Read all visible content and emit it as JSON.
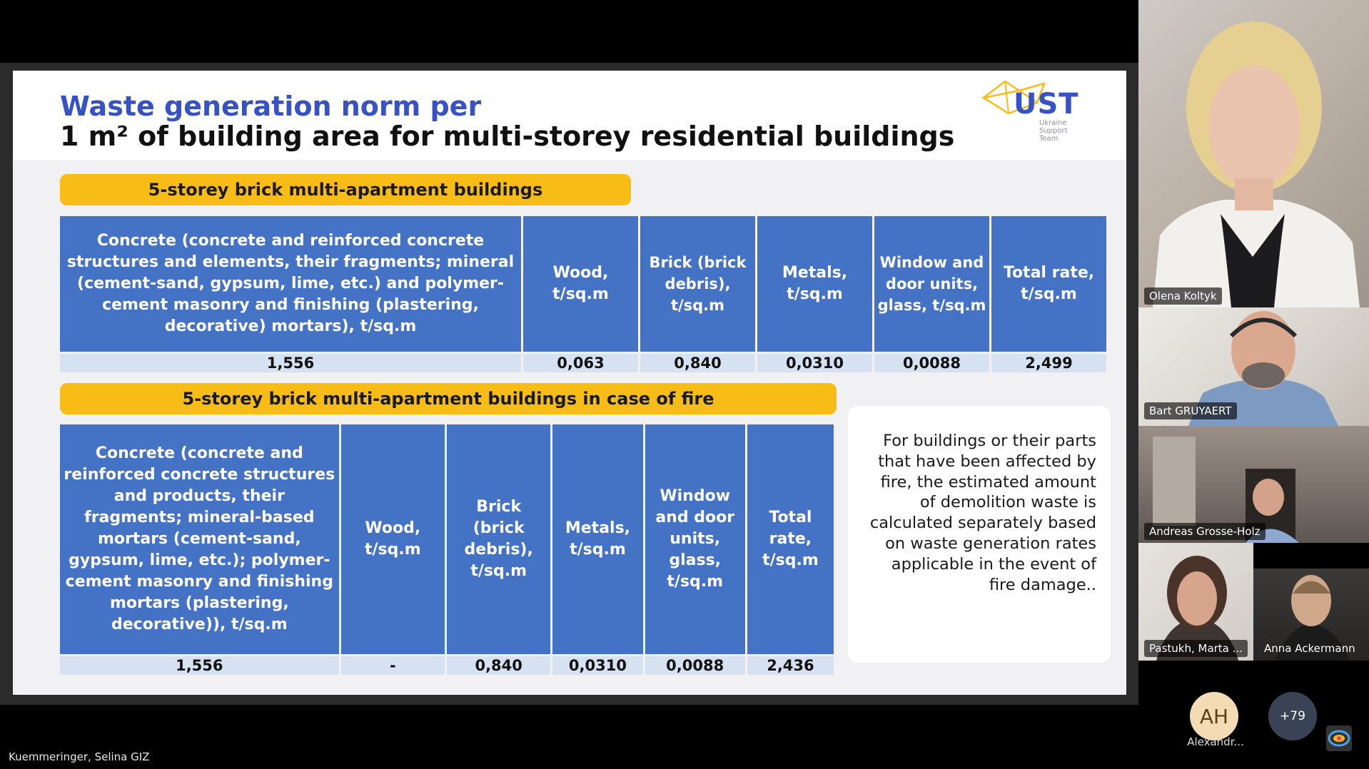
{
  "slide": {
    "title_line1": "Waste generation norm per",
    "title_line2": "1 m² of building area for multi-storey residential buildings",
    "logo": {
      "text": "UST",
      "subtitle": "Ukraine Support Team"
    },
    "section1": {
      "banner": "5-storey brick multi-apartment buildings",
      "headers": [
        "Concrete (concrete and reinforced concrete structures and elements, their fragments; mineral (cement-sand, gypsum, lime, etc.) and polymer-cement masonry and finishing (plastering, decorative) mortars), t/sq.m",
        "Wood, t/sq.m",
        "Brick (brick debris), t/sq.m",
        "Metals, t/sq.m",
        "Window and door units, glass, t/sq.m",
        "Total rate, t/sq.m"
      ],
      "values": [
        "1,556",
        "0,063",
        "0,840",
        "0,0310",
        "0,0088",
        "2,499"
      ]
    },
    "section2": {
      "banner": "5-storey brick multi-apartment buildings in case of fire",
      "headers": [
        "Concrete (concrete and reinforced concrete structures and products, their fragments; mineral-based mortars (cement-sand, gypsum, lime, etc.); polymer-cement masonry and finishing mortars (plastering, decorative)), t/sq.m",
        "Wood, t/sq.m",
        "Brick (brick debris), t/sq.m",
        "Metals, t/sq.m",
        "Window and door units, glass, t/sq.m",
        "Total rate, t/sq.m"
      ],
      "values": [
        "1,556",
        "-",
        "0,840",
        "0,0310",
        "0,0088",
        "2,436"
      ]
    },
    "note": "For buildings or their parts that have been affected by fire, the estimated amount of demolition waste is calculated separately based on waste generation rates applicable in the event of fire damage.."
  },
  "participants": [
    {
      "name": "Olena Koltyk"
    },
    {
      "name": "Bart GRUYAERT"
    },
    {
      "name": "Andreas Grosse-Holz"
    },
    {
      "name": "Pastukh, Marta ..."
    },
    {
      "name": "Anna Ackermann"
    }
  ],
  "overflow": {
    "avatar_initials": "AH",
    "avatar_label": "Alexandr...",
    "more_count": "+79"
  },
  "presenter": {
    "name": "Kuemmeringer, Selina GIZ"
  },
  "colors": {
    "accent_blue": "#3752c4",
    "table_blue": "#4472c4",
    "banner_yellow": "#f7bd16",
    "value_row": "#d6e2f2"
  }
}
